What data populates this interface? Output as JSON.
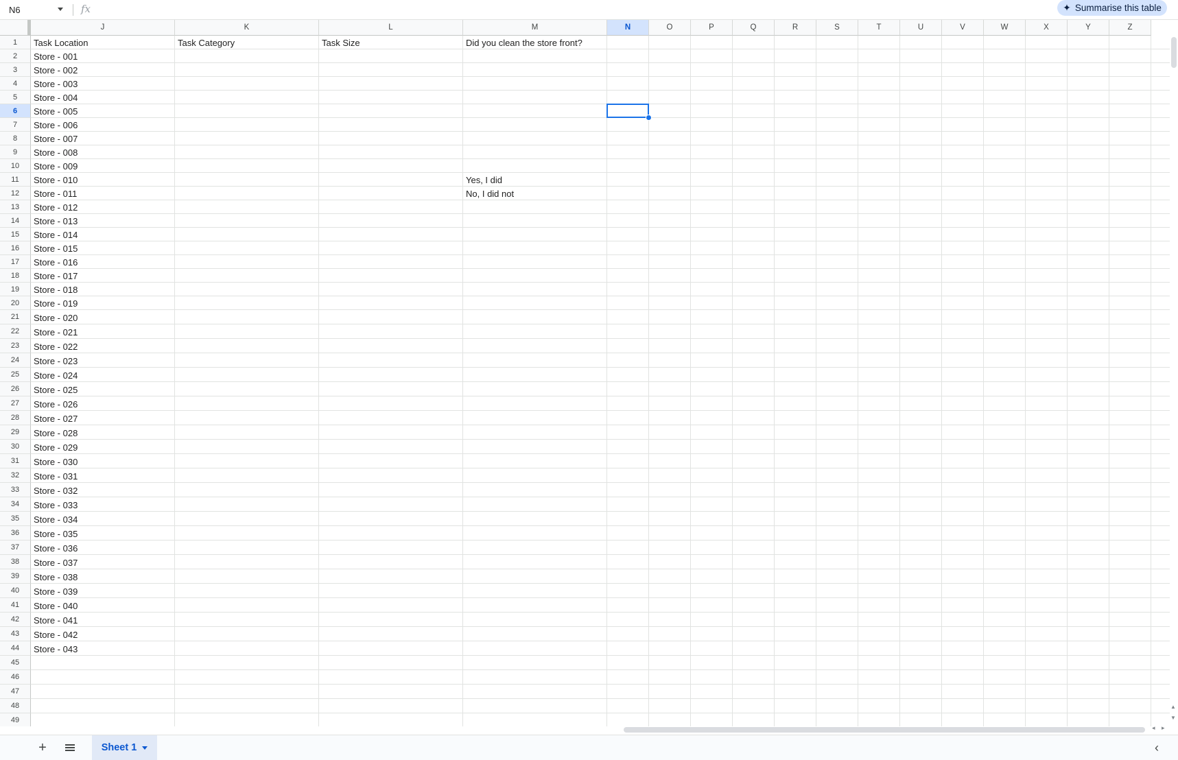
{
  "formula_bar": {
    "name_box": "N6",
    "fx_label": "fx",
    "formula_value": ""
  },
  "summarise_button": {
    "label": "Summarise this table",
    "icon": "sparkle-icon"
  },
  "columns": [
    "J",
    "K",
    "L",
    "M",
    "N",
    "O",
    "P",
    "Q",
    "R",
    "S",
    "T",
    "U",
    "V",
    "W",
    "X",
    "Y",
    "Z"
  ],
  "selected_cell": {
    "column": "N",
    "row": 6
  },
  "rows": [
    [
      "Task Location",
      "Task Category",
      "Task Size",
      "Did you clean the store front?"
    ],
    [
      "Store - 001",
      "",
      "",
      ""
    ],
    [
      "Store - 002",
      "",
      "",
      ""
    ],
    [
      "Store - 003",
      "",
      "",
      ""
    ],
    [
      "Store - 004",
      "",
      "",
      ""
    ],
    [
      "Store - 005",
      "",
      "",
      ""
    ],
    [
      "Store - 006",
      "",
      "",
      ""
    ],
    [
      "Store - 007",
      "",
      "",
      ""
    ],
    [
      "Store - 008",
      "",
      "",
      ""
    ],
    [
      "Store - 009",
      "",
      "",
      ""
    ],
    [
      "Store - 010",
      "",
      "",
      "Yes, I did"
    ],
    [
      "Store - 011",
      "",
      "",
      "No, I did not"
    ],
    [
      "Store - 012",
      "",
      "",
      ""
    ],
    [
      "Store - 013",
      "",
      "",
      ""
    ],
    [
      "Store - 014",
      "",
      "",
      ""
    ],
    [
      "Store - 015",
      "",
      "",
      ""
    ],
    [
      "Store - 016",
      "",
      "",
      ""
    ],
    [
      "Store - 017",
      "",
      "",
      ""
    ],
    [
      "Store - 018",
      "",
      "",
      ""
    ],
    [
      "Store - 019",
      "",
      "",
      ""
    ],
    [
      "Store - 020",
      "",
      "",
      ""
    ],
    [
      "Store - 021",
      "",
      "",
      ""
    ],
    [
      "Store - 022",
      "",
      "",
      ""
    ],
    [
      "Store - 023",
      "",
      "",
      ""
    ],
    [
      "Store - 024",
      "",
      "",
      ""
    ],
    [
      "Store - 025",
      "",
      "",
      ""
    ],
    [
      "Store - 026",
      "",
      "",
      ""
    ],
    [
      "Store - 027",
      "",
      "",
      ""
    ],
    [
      "Store - 028",
      "",
      "",
      ""
    ],
    [
      "Store - 029",
      "",
      "",
      ""
    ],
    [
      "Store - 030",
      "",
      "",
      ""
    ],
    [
      "Store - 031",
      "",
      "",
      ""
    ],
    [
      "Store - 032",
      "",
      "",
      ""
    ],
    [
      "Store - 033",
      "",
      "",
      ""
    ],
    [
      "Store - 034",
      "",
      "",
      ""
    ],
    [
      "Store - 035",
      "",
      "",
      ""
    ],
    [
      "Store - 036",
      "",
      "",
      ""
    ],
    [
      "Store - 037",
      "",
      "",
      ""
    ],
    [
      "Store - 038",
      "",
      "",
      ""
    ],
    [
      "Store - 039",
      "",
      "",
      ""
    ],
    [
      "Store - 040",
      "",
      "",
      ""
    ],
    [
      "Store - 041",
      "",
      "",
      ""
    ],
    [
      "Store - 042",
      "",
      "",
      ""
    ],
    [
      "Store - 043",
      "",
      "",
      ""
    ],
    [
      "",
      "",
      "",
      ""
    ],
    [
      "",
      "",
      "",
      ""
    ],
    [
      "",
      "",
      "",
      ""
    ],
    [
      "",
      "",
      "",
      ""
    ],
    [
      "",
      "",
      "",
      ""
    ]
  ],
  "sheet_tabs": {
    "add_icon": "plus-icon",
    "all_sheets_icon": "hamburger-menu-icon",
    "active_tab": "Sheet 1",
    "collapse_icon": "chevron-left-icon"
  },
  "colors": {
    "selection": "#1a73e8",
    "selected_header": "#d3e3fd",
    "accent": "#0b57d0"
  }
}
